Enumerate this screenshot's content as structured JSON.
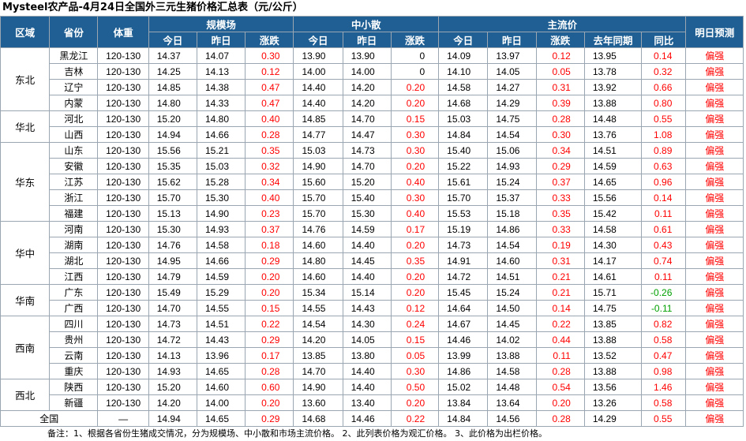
{
  "title": "Mysteel农产品-4月24日全国外三元生猪价格汇总表（元/公斤）",
  "headers": {
    "region": "区域",
    "province": "省份",
    "weight": "体重",
    "large_scale": "规模场",
    "small_scale": "中小散",
    "mainstream": "主流价",
    "forecast": "明日预测",
    "today": "今日",
    "yesterday": "昨日",
    "change": "涨跌",
    "last_year": "去年同期",
    "yoy": "同比"
  },
  "regions": [
    {
      "name": "东北",
      "rows": [
        [
          "黑龙江",
          "120-130",
          "14.37",
          "14.07",
          "0.30",
          "13.90",
          "13.90",
          "0",
          "14.09",
          "13.97",
          "0.12",
          "13.95",
          "0.14",
          "偏强"
        ],
        [
          "吉林",
          "120-130",
          "14.25",
          "14.13",
          "0.12",
          "14.00",
          "14.00",
          "0",
          "14.10",
          "14.05",
          "0.05",
          "13.78",
          "0.32",
          "偏强"
        ],
        [
          "辽宁",
          "120-130",
          "14.85",
          "14.38",
          "0.47",
          "14.40",
          "14.20",
          "0.20",
          "14.58",
          "14.27",
          "0.31",
          "13.92",
          "0.66",
          "偏强"
        ],
        [
          "内蒙",
          "120-130",
          "14.80",
          "14.33",
          "0.47",
          "14.40",
          "14.20",
          "0.20",
          "14.68",
          "14.29",
          "0.39",
          "13.88",
          "0.80",
          "偏强"
        ]
      ]
    },
    {
      "name": "华北",
      "rows": [
        [
          "河北",
          "120-130",
          "15.20",
          "14.80",
          "0.40",
          "14.85",
          "14.70",
          "0.15",
          "15.03",
          "14.75",
          "0.28",
          "14.48",
          "0.55",
          "偏强"
        ],
        [
          "山西",
          "120-130",
          "14.94",
          "14.66",
          "0.28",
          "14.77",
          "14.47",
          "0.30",
          "14.84",
          "14.54",
          "0.30",
          "13.76",
          "1.08",
          "偏强"
        ]
      ]
    },
    {
      "name": "华东",
      "rows": [
        [
          "山东",
          "120-130",
          "15.56",
          "15.21",
          "0.35",
          "15.03",
          "14.73",
          "0.30",
          "15.40",
          "15.06",
          "0.34",
          "14.51",
          "0.89",
          "偏强"
        ],
        [
          "安徽",
          "120-130",
          "15.35",
          "15.03",
          "0.32",
          "14.90",
          "14.70",
          "0.20",
          "15.22",
          "14.93",
          "0.29",
          "14.59",
          "0.63",
          "偏强"
        ],
        [
          "江苏",
          "120-130",
          "15.62",
          "15.28",
          "0.34",
          "15.60",
          "15.20",
          "0.40",
          "15.61",
          "15.24",
          "0.37",
          "14.65",
          "0.96",
          "偏强"
        ],
        [
          "浙江",
          "120-130",
          "15.70",
          "15.30",
          "0.40",
          "15.70",
          "15.40",
          "0.30",
          "15.70",
          "15.37",
          "0.33",
          "15.56",
          "0.14",
          "偏强"
        ],
        [
          "福建",
          "120-130",
          "15.13",
          "14.90",
          "0.23",
          "15.70",
          "15.30",
          "0.40",
          "15.53",
          "15.18",
          "0.35",
          "15.42",
          "0.11",
          "偏强"
        ]
      ]
    },
    {
      "name": "华中",
      "rows": [
        [
          "河南",
          "120-130",
          "15.30",
          "14.93",
          "0.37",
          "14.76",
          "14.59",
          "0.17",
          "15.19",
          "14.86",
          "0.33",
          "14.58",
          "0.61",
          "偏强"
        ],
        [
          "湖南",
          "120-130",
          "14.76",
          "14.58",
          "0.18",
          "14.60",
          "14.40",
          "0.20",
          "14.73",
          "14.54",
          "0.19",
          "14.30",
          "0.43",
          "偏强"
        ],
        [
          "湖北",
          "120-130",
          "14.95",
          "14.66",
          "0.29",
          "14.80",
          "14.45",
          "0.35",
          "14.91",
          "14.60",
          "0.31",
          "14.17",
          "0.74",
          "偏强"
        ],
        [
          "江西",
          "120-130",
          "14.79",
          "14.59",
          "0.20",
          "14.60",
          "14.40",
          "0.20",
          "14.72",
          "14.51",
          "0.21",
          "14.61",
          "0.11",
          "偏强"
        ]
      ]
    },
    {
      "name": "华南",
      "rows": [
        [
          "广东",
          "120-130",
          "15.49",
          "15.29",
          "0.20",
          "15.34",
          "15.14",
          "0.20",
          "15.45",
          "15.24",
          "0.21",
          "15.71",
          "-0.26",
          "偏强"
        ],
        [
          "广西",
          "120-130",
          "14.70",
          "14.55",
          "0.15",
          "14.55",
          "14.43",
          "0.12",
          "14.64",
          "14.50",
          "0.14",
          "14.75",
          "-0.11",
          "偏强"
        ]
      ]
    },
    {
      "name": "西南",
      "rows": [
        [
          "四川",
          "120-130",
          "14.73",
          "14.51",
          "0.22",
          "14.54",
          "14.30",
          "0.24",
          "14.67",
          "14.45",
          "0.22",
          "13.85",
          "0.82",
          "偏强"
        ],
        [
          "贵州",
          "120-130",
          "14.72",
          "14.43",
          "0.29",
          "14.20",
          "14.05",
          "0.15",
          "14.46",
          "14.02",
          "0.44",
          "13.88",
          "0.58",
          "偏强"
        ],
        [
          "云南",
          "120-130",
          "14.13",
          "13.96",
          "0.17",
          "13.85",
          "13.80",
          "0.05",
          "13.99",
          "13.88",
          "0.11",
          "13.52",
          "0.47",
          "偏强"
        ],
        [
          "重庆",
          "120-130",
          "14.93",
          "14.65",
          "0.28",
          "14.70",
          "14.40",
          "0.30",
          "14.86",
          "14.58",
          "0.28",
          "13.88",
          "0.98",
          "偏强"
        ]
      ]
    },
    {
      "name": "西北",
      "rows": [
        [
          "陕西",
          "120-130",
          "15.20",
          "14.60",
          "0.60",
          "14.90",
          "14.40",
          "0.50",
          "15.02",
          "14.48",
          "0.54",
          "13.56",
          "1.46",
          "偏强"
        ],
        [
          "新疆",
          "120-130",
          "14.20",
          "14.00",
          "0.20",
          "13.60",
          "13.40",
          "0.20",
          "13.84",
          "13.64",
          "0.20",
          "13.26",
          "0.58",
          "偏强"
        ]
      ]
    }
  ],
  "national": [
    "全国",
    "—",
    "14.94",
    "14.65",
    "0.29",
    "14.68",
    "14.46",
    "0.22",
    "14.84",
    "14.56",
    "0.28",
    "14.29",
    "0.55",
    "偏强"
  ],
  "footnote": "备注：1、根据各省份生猪成交情况，分为规模场、中小散和市场主流价格。   2、此列表价格为观汇价格。   3、此价格为出栏价格。",
  "colors": {
    "header_bg": "#1f5f93",
    "header_text": "#ffffff",
    "up": "#ff0000",
    "down": "#00a000",
    "grid": "#9aa6b2"
  }
}
